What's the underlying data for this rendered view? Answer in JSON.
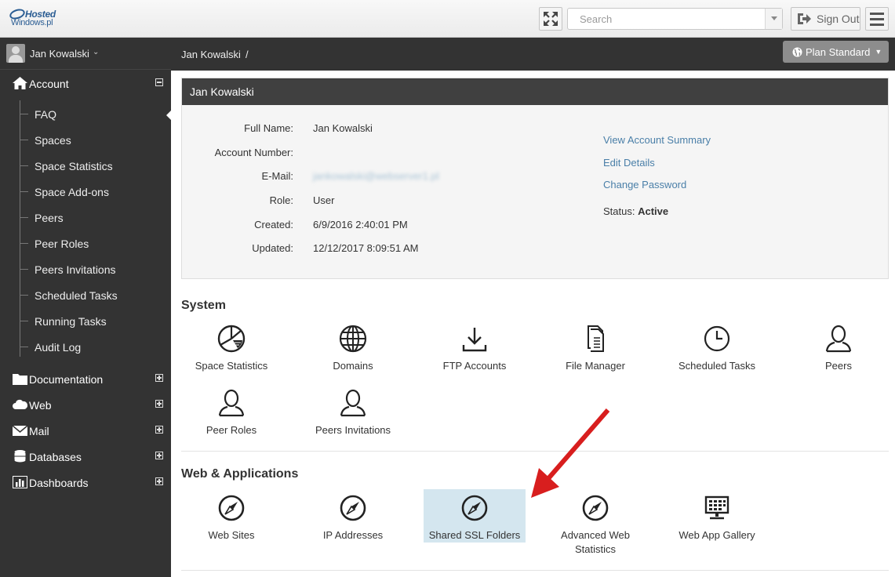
{
  "header": {
    "logo_line1": "Hosted",
    "logo_line2": "Windows.pl",
    "search_placeholder": "Search",
    "signout_label": "Sign Out"
  },
  "sidebar": {
    "user_name": "Jan Kowalski",
    "sections": [
      {
        "label": "Account",
        "icon": "home-icon",
        "expanded": true
      },
      {
        "label": "Documentation",
        "icon": "folder-icon",
        "expanded": false
      },
      {
        "label": "Web",
        "icon": "cloud-icon",
        "expanded": false
      },
      {
        "label": "Mail",
        "icon": "envelope-icon",
        "expanded": false
      },
      {
        "label": "Databases",
        "icon": "database-icon",
        "expanded": false
      },
      {
        "label": "Dashboards",
        "icon": "bar-chart-icon",
        "expanded": false
      }
    ],
    "account_items": [
      "FAQ",
      "Spaces",
      "Space Statistics",
      "Space Add-ons",
      "Peers",
      "Peer Roles",
      "Peers Invitations",
      "Scheduled Tasks",
      "Running Tasks",
      "Audit Log"
    ]
  },
  "breadcrumb": {
    "item": "Jan Kowalski",
    "separator": "/",
    "plan_label": "Plan Standard"
  },
  "account": {
    "title": "Jan Kowalski",
    "fields": [
      {
        "label": "Full Name:",
        "value": "Jan Kowalski"
      },
      {
        "label": "Account Number:",
        "value": ""
      },
      {
        "label": "E-Mail:",
        "value": "jankowalski@webserver1.pl"
      },
      {
        "label": "Role:",
        "value": "User"
      },
      {
        "label": "Created:",
        "value": "6/9/2016 2:40:01 PM"
      },
      {
        "label": "Updated:",
        "value": "12/12/2017 8:09:51 AM"
      }
    ],
    "links": [
      "View Account Summary",
      "Edit Details",
      "Change Password"
    ],
    "status_label": "Status:",
    "status_value": "Active"
  },
  "system": {
    "title": "System",
    "tiles": [
      {
        "label": "Space Statistics",
        "icon": "pie-chart-icon"
      },
      {
        "label": "Domains",
        "icon": "globe-icon"
      },
      {
        "label": "FTP Accounts",
        "icon": "download-icon"
      },
      {
        "label": "File Manager",
        "icon": "document-icon"
      },
      {
        "label": "Scheduled Tasks",
        "icon": "clock-icon"
      },
      {
        "label": "Peers",
        "icon": "user-icon"
      },
      {
        "label": "Peer Roles",
        "icon": "user-icon"
      },
      {
        "label": "Peers Invitations",
        "icon": "user-icon"
      }
    ]
  },
  "web": {
    "title": "Web & Applications",
    "tiles": [
      {
        "label": "Web Sites",
        "icon": "compass-icon"
      },
      {
        "label": "IP Addresses",
        "icon": "compass-icon"
      },
      {
        "label": "Shared SSL Folders",
        "icon": "compass-icon",
        "highlighted": true
      },
      {
        "label": "Advanced Web Statistics",
        "icon": "compass-icon"
      },
      {
        "label": "Web App Gallery",
        "icon": "monitor-grid-icon"
      }
    ]
  },
  "colors": {
    "sidebar_bg": "#333333",
    "link": "#4a7fa8",
    "highlight_tile": "#d4e6ef",
    "annotation_arrow": "#d81e1e"
  }
}
